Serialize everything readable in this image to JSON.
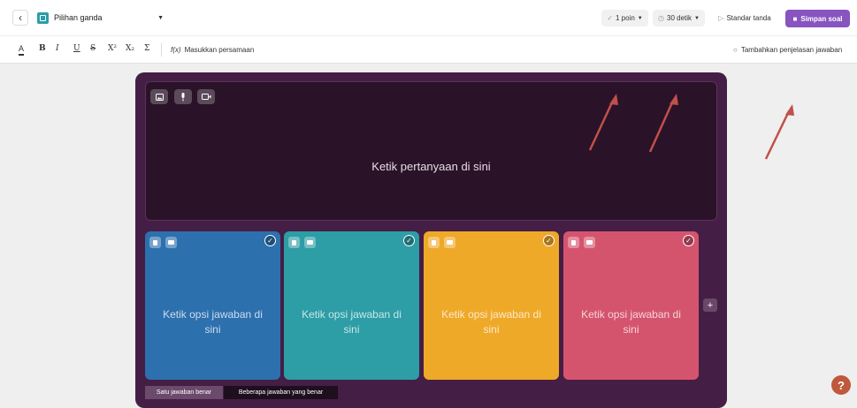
{
  "header": {
    "back_icon": "chevron-left-icon",
    "question_type": "Pilihan ganda",
    "points": "1 poin",
    "time": "30 detik",
    "standard_mark": "Standar tanda",
    "save": "Simpan soal"
  },
  "toolbar": {
    "text_color": "A",
    "bold": "B",
    "italic": "I",
    "underline": "U",
    "strikethrough": "S",
    "superscript": "X²",
    "subscript": "X₂",
    "sigma": "Σ",
    "equation_label": "Masukkan persamaan",
    "explanation_label": "Tambahkan penjelasan jawaban"
  },
  "question": {
    "placeholder": "Ketik pertanyaan di sini"
  },
  "options": [
    {
      "text": "Ketik opsi jawaban di sini",
      "color": "#2d70ae"
    },
    {
      "text": "Ketik opsi jawaban di sini",
      "color": "#2d9da6"
    },
    {
      "text": "Ketik opsi jawaban di sini",
      "color": "#efa929"
    },
    {
      "text": "Ketik opsi jawaban di sini",
      "color": "#d5546d"
    }
  ],
  "add_option": "+",
  "answer_modes": {
    "single": "Satu jawaban benar",
    "multiple": "Beberapa jawaban yang benar"
  },
  "help": "?",
  "colors": {
    "accent": "#8854c0",
    "editor_bg": "#451e45",
    "question_bg": "#2a1228",
    "annotation_arrow": "#c0504a"
  }
}
